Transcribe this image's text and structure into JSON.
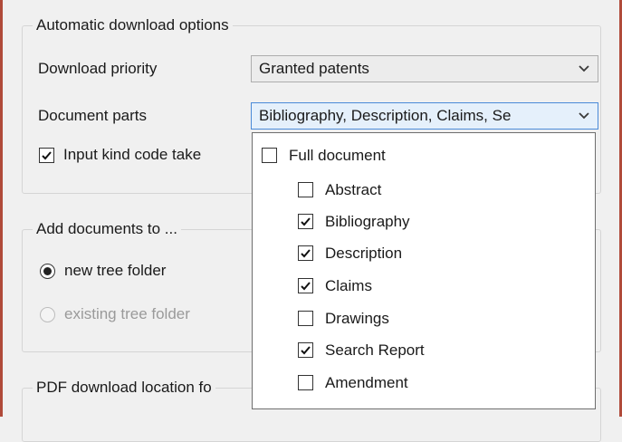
{
  "auto_options": {
    "legend": "Automatic download options",
    "priority_label": "Download priority",
    "priority_value": "Granted patents",
    "parts_label": "Document parts",
    "parts_value": "Bibliography, Description, Claims, Se",
    "input_kind_label": "Input kind code take",
    "input_kind_checked": true
  },
  "add_to": {
    "legend": "Add documents to ...",
    "new_folder_label": "new tree folder",
    "new_folder_selected": true,
    "existing_folder_label": "existing tree folder",
    "existing_folder_enabled": false
  },
  "pdf": {
    "legend": "PDF download location fo"
  },
  "parts_dropdown": {
    "items": [
      {
        "label": "Full document",
        "checked": false
      },
      {
        "label": "Abstract",
        "checked": false
      },
      {
        "label": "Bibliography",
        "checked": true
      },
      {
        "label": "Description",
        "checked": true
      },
      {
        "label": "Claims",
        "checked": true
      },
      {
        "label": "Drawings",
        "checked": false
      },
      {
        "label": "Search Report",
        "checked": true
      },
      {
        "label": "Amendment",
        "checked": false
      }
    ]
  },
  "icons": {
    "combo_arrow": "chevron-down-icon",
    "check": "check-icon"
  },
  "colors": {
    "window_border": "#b04a3a",
    "background": "#f0f0f0",
    "dropdown_bg": "#ffffff"
  }
}
